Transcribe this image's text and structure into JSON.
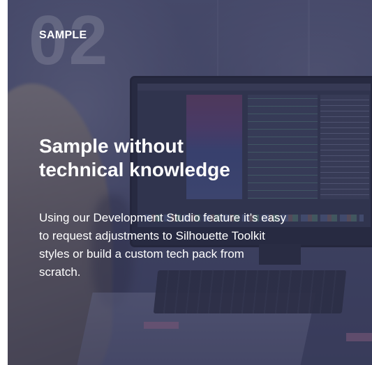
{
  "card": {
    "number": "02",
    "eyebrow": "SAMPLE",
    "headline_line1": "Sample without",
    "headline_line2": "technical knowledge",
    "body_line1": "Using our Development Studio feature it’s easy",
    "body_line2": "to request adjustments to Silhouette Toolkit",
    "body_line3": "styles or build a custom tech pack from",
    "body_line4": "scratch."
  },
  "colors": {
    "overlay": "#34385c",
    "text": "#ffffff"
  }
}
